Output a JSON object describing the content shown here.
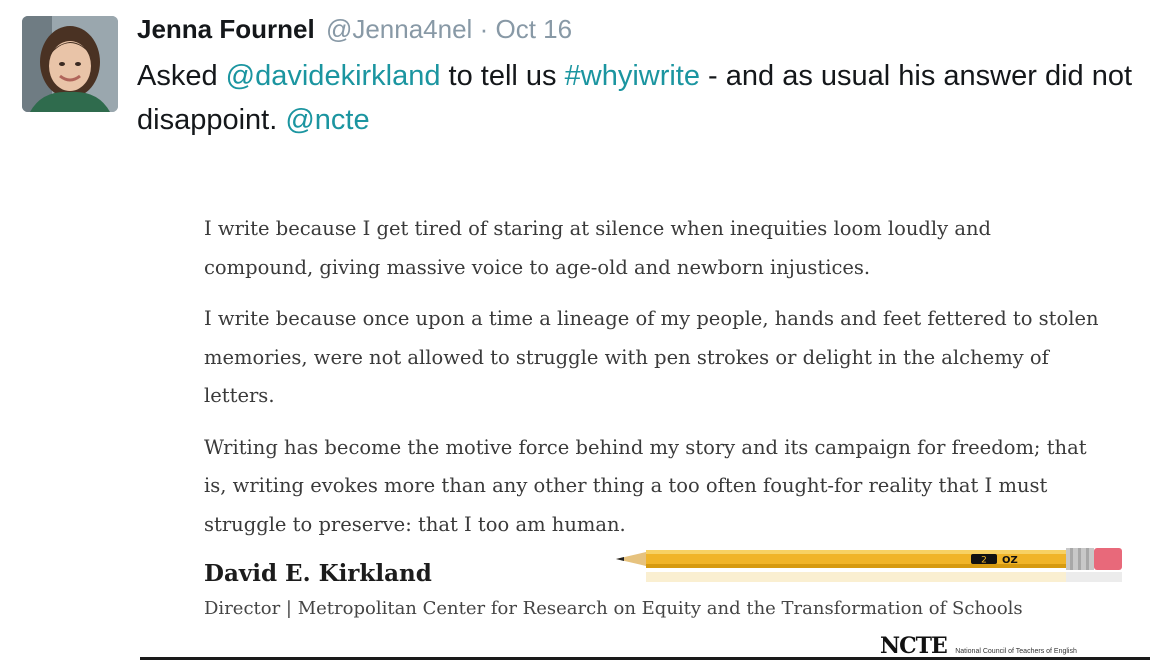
{
  "tweet": {
    "author_name": "Jenna Fournel",
    "handle": "@Jenna4nel",
    "separator": "·",
    "date": "Oct 16",
    "text_parts": {
      "p1": "Asked ",
      "mention1": "@davidekirkland",
      "p2": " to tell us ",
      "hashtag": "#whyiwrite",
      "p3": " - and as usual his answer did not disappoint. ",
      "mention2": "@ncte"
    }
  },
  "image": {
    "paragraph1": "I write because I get tired of staring at silence when inequities loom loudly and compound, giving massive voice to age-old and newborn injustices.",
    "paragraph2": "I write because once upon a time a lineage of my people, hands and feet fettered to stolen memories, were not allowed to struggle with pen strokes or delight in the alchemy of letters.",
    "paragraph3": "Writing has become the motive force behind my story and its campaign for freedom; that is, writing evokes more than any other thing a too often fought-for reality that I must struggle to preserve: that I too am human.",
    "author": "David E. Kirkland",
    "title": "Director | Metropolitan Center for Research on Equity and the Transformation of Schools",
    "logo_text": "NCTE",
    "logo_subtext": "National Council of Teachers of English",
    "pencil_mark": "2",
    "pencil_brand": "OZ"
  },
  "colors": {
    "link": "#1b95a0",
    "name": "#14171a",
    "muted": "#8899a6",
    "pencil": "#f0b429"
  }
}
